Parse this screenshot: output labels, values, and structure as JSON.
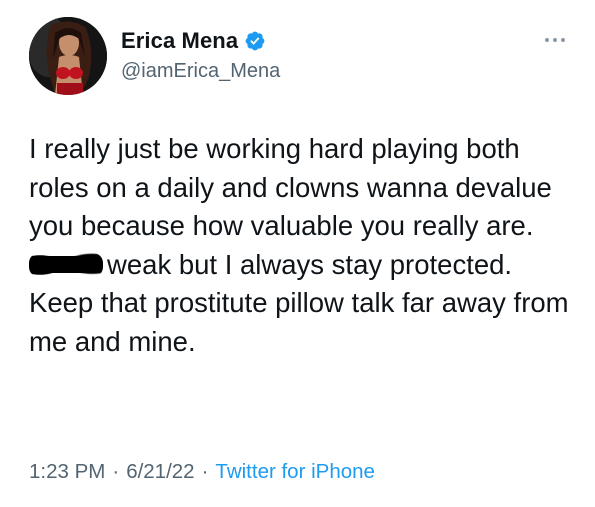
{
  "author": {
    "display_name": "Erica Mena",
    "handle": "@iamErica_Mena",
    "verified": true
  },
  "tweet": {
    "text_before_censor": "I really just be working hard playing both roles on a daily and clowns wanna devalue you because how valuable you really are. ",
    "text_after_censor": "weak but I always stay protected. Keep that prostitute pillow talk far away from me and mine."
  },
  "meta": {
    "time": "1:23 PM",
    "separator_1": "·",
    "date": "6/21/22",
    "separator_2": "·",
    "source": "Twitter for iPhone"
  },
  "colors": {
    "text": "#0f1419",
    "secondary": "#536471",
    "accent": "#1d9bf0"
  },
  "icons": {
    "verified": "verified-badge-icon",
    "more": "more-dots-icon"
  }
}
